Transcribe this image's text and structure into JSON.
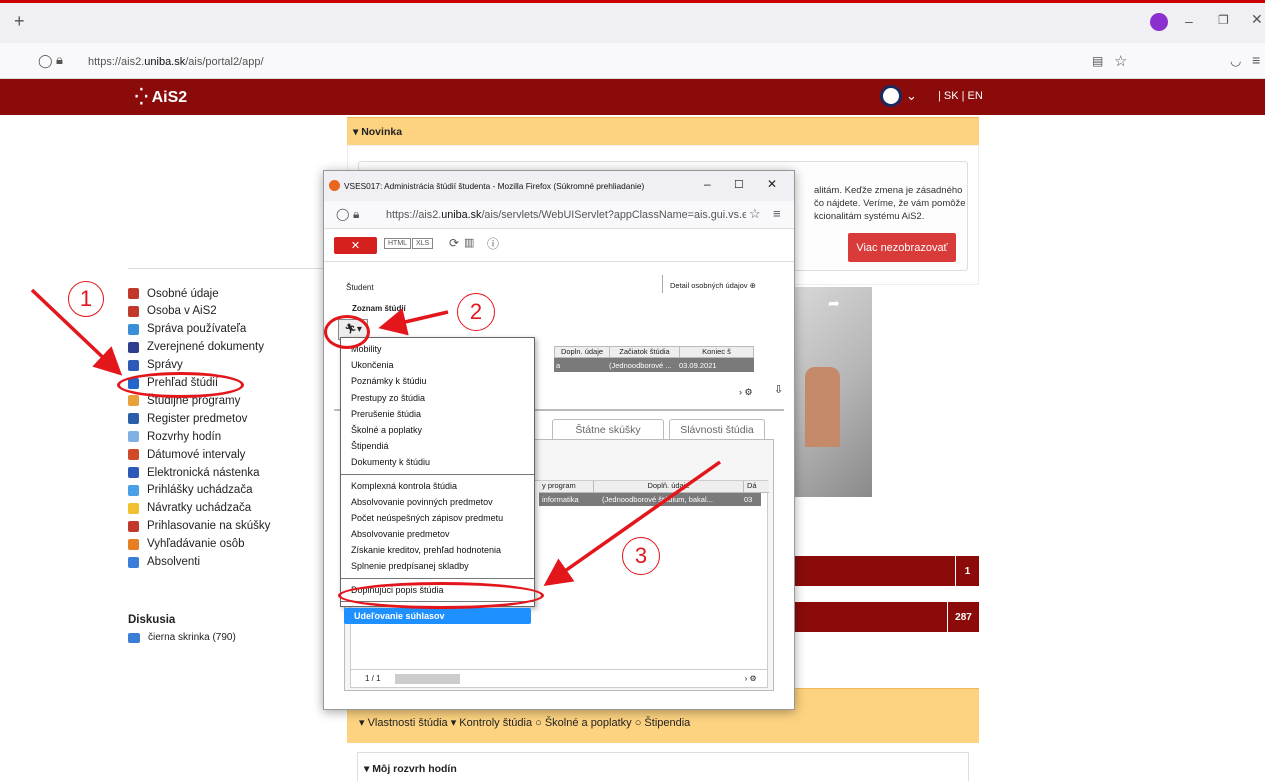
{
  "browser": {
    "url_prefix": "https://ais2.",
    "url_domain": "uniba.sk",
    "url_path": "/ais/portal2/app/"
  },
  "header": {
    "logo": "AiS2",
    "lang": "| SK | EN"
  },
  "sidebar": {
    "items": [
      {
        "label": "Osobné údaje",
        "color": "#c0392b"
      },
      {
        "label": "Osoba v AiS2",
        "color": "#c0392b"
      },
      {
        "label": "Správa používateľa",
        "color": "#3b8fd8"
      },
      {
        "label": "Zverejnené dokumenty",
        "color": "#2d3e8e"
      },
      {
        "label": "Správy",
        "color": "#2d59b8"
      },
      {
        "label": "Prehľad štúdií",
        "color": "#2266cc"
      },
      {
        "label": "Študijné programy",
        "color": "#e8a23a"
      },
      {
        "label": "Register predmetov",
        "color": "#2b5ea8"
      },
      {
        "label": "Rozvrhy hodín",
        "color": "#7fb2e3"
      },
      {
        "label": "Dátumové intervaly",
        "color": "#d04a2a"
      },
      {
        "label": "Elektronická nástenka",
        "color": "#2d59b8"
      },
      {
        "label": "Prihlášky uchádzača",
        "color": "#4aa0e6"
      },
      {
        "label": "Návratky uchádzača",
        "color": "#f0c030"
      },
      {
        "label": "Prihlasovanie na skúšky",
        "color": "#c0392b"
      },
      {
        "label": "Vyhľadávanie osôb",
        "color": "#e67e22"
      },
      {
        "label": "Absolventi",
        "color": "#3b7ed8"
      }
    ],
    "discussion_title": "Diskusia",
    "discussion_item": "čierna skrinka (790)"
  },
  "main": {
    "novinka": "▾ Novinka",
    "news_lines": [
      "alitám. Keďže zmena je zásadného",
      "čo nájdete. Veríme, že vám pomôže",
      "kcionalitám systému AiS2."
    ],
    "dismiss": "Viac nezobrazovať",
    "badge1": "1",
    "badge2": "287",
    "study_links": "▾ Vlastnosti štúdia  ▾ Kontroly štúdia  ○ Školné a poplatky  ○ Štipendia",
    "rozvrh": "▾ Môj rozvrh hodín"
  },
  "popup": {
    "title": "VSES017: Administrácia štúdií študenta - Mozilla Firefox (Súkromné prehliadanie)",
    "url_prefix": "https://ais2.",
    "url_domain": "uniba.sk",
    "url_path": "/ais/servlets/WebUIServlet?appClassName=ais.gui.vs.e",
    "student_label": "Študent",
    "detail": "Detail osobných údajov",
    "zoznam": "Zoznam štúdií",
    "cols1": [
      "Dopln. údaje",
      "Začiatok štúdia",
      "Koniec š"
    ],
    "row1": [
      "a",
      "(Jednoodborové ...",
      "03.09.2021"
    ],
    "tabs": [
      "Štátne skúšky",
      "Slávnosti štúdia"
    ],
    "cols2": [
      "y program",
      "Doplň. údaje",
      "Dá"
    ],
    "row2": [
      "informatika",
      "(Jednoodborové štúdium, bakal...",
      "03"
    ],
    "pager": "1  /  1",
    "menu_group1": [
      "Mobility",
      "Ukončenia",
      "Poznámky k štúdiu",
      "Prestupy zo štúdia",
      "Prerušenie štúdia",
      "Školné a poplatky",
      "Štipendiá",
      "Dokumenty k štúdiu"
    ],
    "menu_group2": [
      "Komplexná kontrola štúdia",
      "Absolvovanie povinných predmetov",
      "Počet neúspešných zápisov predmetu",
      "Absolvovanie predmetov",
      "Získanie kreditov, prehľad hodnotenia",
      "Splnenie predpísanej skladby"
    ],
    "menu_group3": [
      "Doplňujúci popis štúdia"
    ],
    "menu_selected": "Udeľovanie súhlasov"
  },
  "annotations": {
    "n1": "1",
    "n2": "2",
    "n3": "3",
    "color": "#e3161c"
  }
}
